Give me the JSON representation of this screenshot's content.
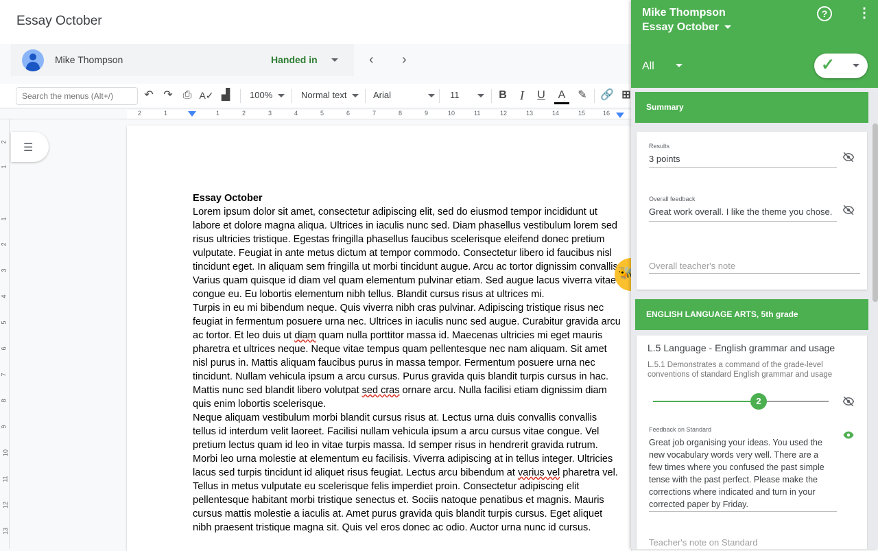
{
  "titlebar": {
    "doc_title": "Essay October"
  },
  "student_bar": {
    "name": "Mike Thompson",
    "status": "Handed in",
    "prev_icon": "chevron-left-icon",
    "next_icon": "chevron-right-icon"
  },
  "toolbar": {
    "search_placeholder": "Search the menus (Alt+/)",
    "zoom": "100%",
    "style": "Normal text",
    "font": "Arial",
    "size": "11",
    "icons": [
      "undo-icon",
      "redo-icon",
      "print-icon",
      "spellcheck-icon",
      "paint-format-icon",
      "bold-icon",
      "italic-icon",
      "underline-icon",
      "text-color-icon",
      "highlight-icon",
      "link-icon"
    ]
  },
  "ruler": {
    "h_ticks": [
      "2",
      "1",
      "1",
      "2",
      "3",
      "4",
      "5",
      "6",
      "7",
      "8",
      "9",
      "10",
      "11",
      "12",
      "13",
      "14",
      "15",
      "16"
    ],
    "v_ticks": [
      "2",
      "1",
      "1",
      "2",
      "3",
      "4",
      "5",
      "6",
      "7",
      "8",
      "9",
      "10",
      "11",
      "12",
      "13"
    ]
  },
  "document": {
    "heading": "Essay October",
    "p1": "Lorem ipsum dolor sit amet, consectetur adipiscing elit, sed do eiusmod tempor incididunt ut labore et dolore magna aliqua. Ultrices in iaculis nunc sed. Diam phasellus vestibulum lorem sed risus ultricies tristique. Egestas fringilla phasellus faucibus scelerisque eleifend donec pretium vulputate. Feugiat in ante metus dictum at tempor commodo. Consectetur libero id faucibus nisl tincidunt eget. In aliquam sem fringilla ut morbi tincidunt augue. Arcu ac tortor dignissim convallis. Varius quam quisque id diam vel quam elementum pulvinar etiam. Sed augue lacus viverra vitae congue eu. Eu lobortis elementum nibh tellus. Blandit cursus risus at ultrices mi.",
    "p2a": "Turpis in eu mi bibendum neque. Quis viverra nibh cras pulvinar. Adipiscing tristique risus nec feugiat in fermentum posuere urna nec. Ultrices in iaculis nunc sed augue. Curabitur gravida arcu ac tortor. Et leo duis ut ",
    "p2_sp1": "diam",
    "p2b": " quam nulla porttitor massa id. Maecenas ultricies mi eget mauris pharetra et ultrices neque. Neque vitae tempus quam pellentesque nec nam aliquam. Sit amet nisl purus in. Mattis aliquam faucibus purus in massa tempor. Fermentum posuere urna nec tincidunt. Nullam vehicula ipsum a arcu cursus. Purus gravida quis blandit turpis cursus in hac. Mattis nunc sed blandit libero volutpat ",
    "p2_sp2": "sed cras",
    "p2c": " ornare arcu. Nulla facilisi etiam dignissim diam quis enim lobortis scelerisque.",
    "p3a": "Neque aliquam vestibulum morbi blandit cursus risus at. Lectus urna duis convallis convallis tellus id interdum velit laoreet. Facilisi nullam vehicula ipsum a arcu cursus vitae congue. Vel pretium lectus quam id leo in vitae turpis massa. Id semper risus in hendrerit gravida rutrum. Morbi leo urna molestie at elementum eu facilisis. Viverra adipiscing at in tellus integer. Ultricies lacus sed turpis tincidunt id aliquet risus feugiat. Lectus arcu bibendum at ",
    "p3_sp1": "varius vel",
    "p3b": " pharetra vel. Tellus in metus vulputate eu scelerisque felis imperdiet proin. Consectetur adipiscing elit pellentesque habitant morbi tristique senectus et. Sociis natoque penatibus et magnis. Mauris cursus mattis molestie a iaculis at. Amet purus gravida quis blandit turpis cursus. Eget aliquet nibh praesent tristique magna sit. Quis vel eros donec ac odio. Auctor urna nunc id cursus."
  },
  "panel": {
    "student_name": "Mike Thompson",
    "assignment": "Essay October",
    "filter": "All",
    "accent": "#4caf50",
    "summary": {
      "title": "Summary",
      "results_label": "Results",
      "results_value": "3 points",
      "feedback_label": "Overall feedback",
      "feedback_value": "Great work overall. I like the theme you chose.",
      "teacher_note_placeholder": "Overall teacher's note"
    },
    "standards": {
      "title": "ENGLISH LANGUAGE ARTS, 5th grade",
      "standard_title": "L.5 Language - English grammar and usage",
      "standard_desc": "L.5.1 Demonstrates a command of the grade-level conventions of standard English grammar and usage",
      "level": "2",
      "feedback_label": "Feedback on Standard",
      "feedback_value": "Great job organising your ideas. You used the new vocabulary words very well. There are a few times where you confused the past simple tense with the past perfect. Please make the corrections where indicated and turn in your corrected paper by Friday.",
      "teacher_note_placeholder": "Teacher's note on Standard"
    }
  }
}
